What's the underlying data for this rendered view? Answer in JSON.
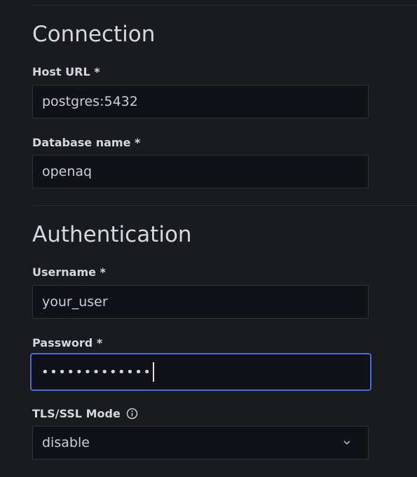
{
  "connection": {
    "title": "Connection",
    "host_label": "Host URL *",
    "host_value": "postgres:5432",
    "db_label": "Database name *",
    "db_value": "openaq"
  },
  "authentication": {
    "title": "Authentication",
    "username_label": "Username *",
    "username_value": "your_user",
    "password_label": "Password *",
    "password_masked": "•••••••••••••",
    "tls_label": "TLS/SSL Mode",
    "tls_value": "disable"
  },
  "icons": {
    "tls_info": "info-icon",
    "tls_dropdown": "chevron-down-icon"
  },
  "colors": {
    "background": "#1a1b1f",
    "input_background": "#111217",
    "focus_border": "#4a6fd8"
  }
}
